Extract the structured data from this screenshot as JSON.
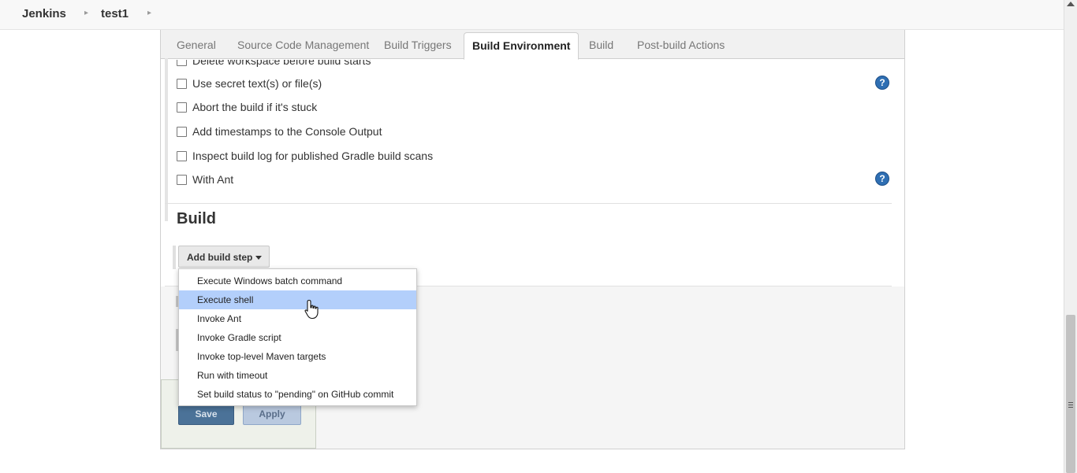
{
  "breadcrumb": {
    "items": [
      "Jenkins",
      "test1"
    ]
  },
  "tabs": [
    "General",
    "Source Code Management",
    "Build Triggers",
    "Build Environment",
    "Build",
    "Post-build Actions"
  ],
  "active_tab": "Build Environment",
  "build_environment": {
    "options": [
      {
        "label": "Delete workspace before build starts",
        "checked": false
      },
      {
        "label": "Use secret text(s) or file(s)",
        "checked": false,
        "help": true
      },
      {
        "label": "Abort the build if it's stuck",
        "checked": false
      },
      {
        "label": "Add timestamps to the Console Output",
        "checked": false
      },
      {
        "label": "Inspect build log for published Gradle build scans",
        "checked": false
      },
      {
        "label": "With Ant",
        "checked": false,
        "help": true
      }
    ]
  },
  "build_section": {
    "title": "Build",
    "add_step_label": "Add build step",
    "menu_items": [
      "Execute Windows batch command",
      "Execute shell",
      "Invoke Ant",
      "Invoke Gradle script",
      "Invoke top-level Maven targets",
      "Run with timeout",
      "Set build status to \"pending\" on GitHub commit"
    ],
    "highlighted_item": "Execute shell"
  },
  "actions": {
    "save_label": "Save",
    "apply_label": "Apply"
  },
  "icons": {
    "help": "help-icon",
    "cursor": "hand-pointer-icon",
    "caret": "caret-down-icon"
  },
  "colors": {
    "help_blue": "#2f6fb3",
    "menu_highlight": "#b3cffb",
    "save_button": "#4b7298"
  }
}
